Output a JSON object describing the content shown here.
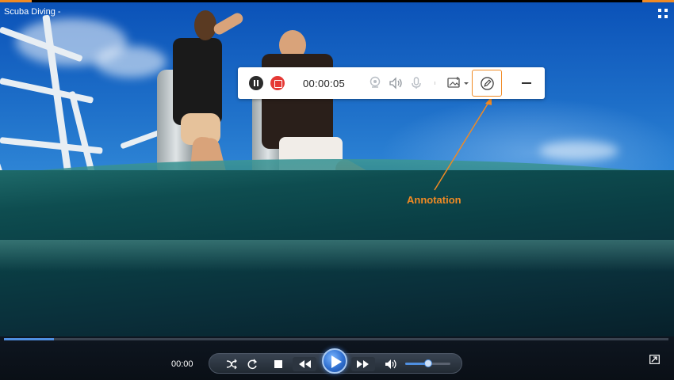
{
  "window": {
    "title": "Scuba Diving -",
    "accent_color": "#f08a24"
  },
  "recorder": {
    "timer": "00:00:05",
    "icons": [
      "pause-icon",
      "stop-icon",
      "webcam-icon",
      "speaker-icon",
      "microphone-icon",
      "screenshot-icon",
      "annotation-icon",
      "minimize-icon"
    ],
    "record_color": "#e53935"
  },
  "callout": {
    "label": "Annotation"
  },
  "player": {
    "current_time": "00:00",
    "seek_progress": 0.075,
    "volume_level": 0.5,
    "icons": [
      "shuffle-icon",
      "repeat-icon",
      "stop-icon",
      "rewind-icon",
      "play-icon",
      "fast-forward-icon",
      "volume-icon",
      "switch-to-compact-icon"
    ],
    "accent_color": "#4f8fe0"
  }
}
